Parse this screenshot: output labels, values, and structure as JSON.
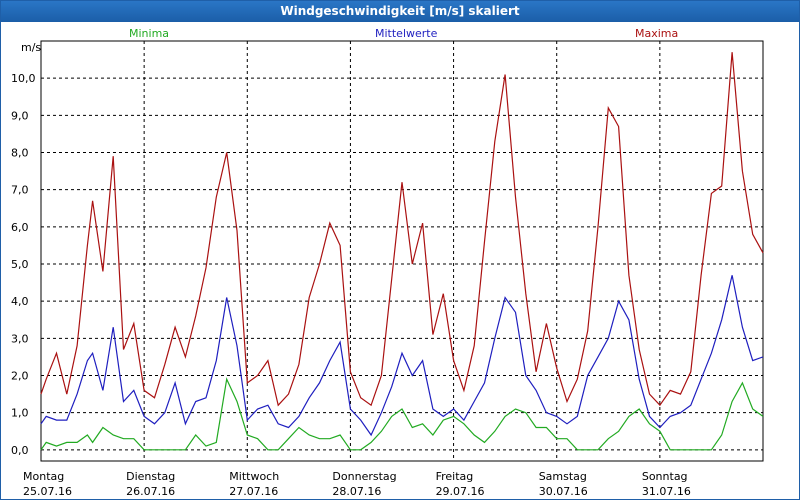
{
  "window": {
    "title": "Windgeschwindigkeit [m/s] skaliert"
  },
  "chart_data": {
    "type": "line",
    "title": "Windgeschwindigkeit [m/s] skaliert",
    "ylabel": "m/s",
    "ylim": [
      -0.3,
      11.0
    ],
    "yticks": [
      "0,0",
      "1,0",
      "2,0",
      "3,0",
      "4,0",
      "5,0",
      "6,0",
      "7,0",
      "8,0",
      "9,0",
      "10,0"
    ],
    "ytick_values": [
      0,
      1,
      2,
      3,
      4,
      5,
      6,
      7,
      8,
      9,
      10
    ],
    "xlim": [
      0,
      7
    ],
    "grid": true,
    "legend_position": "top",
    "days": [
      {
        "weekday": "Montag",
        "date": "25.07.16"
      },
      {
        "weekday": "Dienstag",
        "date": "26.07.16"
      },
      {
        "weekday": "Mittwoch",
        "date": "27.07.16"
      },
      {
        "weekday": "Donnerstag",
        "date": "28.07.16"
      },
      {
        "weekday": "Freitag",
        "date": "29.07.16"
      },
      {
        "weekday": "Samstag",
        "date": "30.07.16"
      },
      {
        "weekday": "Sonntag",
        "date": "31.07.16"
      }
    ],
    "series": [
      {
        "name": "Minima",
        "color": "#22aa22",
        "x": [
          0,
          0.05,
          0.15,
          0.25,
          0.35,
          0.45,
          0.5,
          0.6,
          0.7,
          0.8,
          0.9,
          1.0,
          1.1,
          1.2,
          1.3,
          1.4,
          1.5,
          1.6,
          1.7,
          1.8,
          1.9,
          2.0,
          2.1,
          2.2,
          2.3,
          2.4,
          2.5,
          2.6,
          2.7,
          2.8,
          2.9,
          3.0,
          3.1,
          3.2,
          3.3,
          3.4,
          3.5,
          3.6,
          3.7,
          3.8,
          3.9,
          4.0,
          4.1,
          4.2,
          4.3,
          4.4,
          4.5,
          4.6,
          4.7,
          4.8,
          4.9,
          5.0,
          5.1,
          5.2,
          5.3,
          5.4,
          5.5,
          5.6,
          5.7,
          5.8,
          5.9,
          6.0,
          6.1,
          6.2,
          6.3,
          6.4,
          6.5,
          6.6,
          6.7,
          6.8,
          6.9,
          7.0
        ],
        "values": [
          0.0,
          0.2,
          0.1,
          0.2,
          0.2,
          0.4,
          0.2,
          0.6,
          0.4,
          0.3,
          0.3,
          0.0,
          0.0,
          0.0,
          0.0,
          0.0,
          0.4,
          0.1,
          0.2,
          1.9,
          1.3,
          0.4,
          0.3,
          0.0,
          0.0,
          0.3,
          0.6,
          0.4,
          0.3,
          0.3,
          0.4,
          0.0,
          0.0,
          0.2,
          0.5,
          0.9,
          1.1,
          0.6,
          0.7,
          0.4,
          0.8,
          0.9,
          0.7,
          0.4,
          0.2,
          0.5,
          0.9,
          1.1,
          1.0,
          0.6,
          0.6,
          0.3,
          0.3,
          0.0,
          0.0,
          0.0,
          0.3,
          0.5,
          0.9,
          1.1,
          0.7,
          0.5,
          0.0,
          0.0,
          0.0,
          0.0,
          0.0,
          0.4,
          1.3,
          1.8,
          1.1,
          0.9
        ]
      },
      {
        "name": "Mittelwerte",
        "color": "#1f1fbf",
        "x": [
          0,
          0.05,
          0.15,
          0.25,
          0.35,
          0.45,
          0.5,
          0.6,
          0.7,
          0.8,
          0.9,
          1.0,
          1.1,
          1.2,
          1.3,
          1.4,
          1.5,
          1.6,
          1.7,
          1.8,
          1.9,
          2.0,
          2.1,
          2.2,
          2.3,
          2.4,
          2.5,
          2.6,
          2.7,
          2.8,
          2.9,
          3.0,
          3.1,
          3.2,
          3.3,
          3.4,
          3.5,
          3.6,
          3.7,
          3.8,
          3.9,
          4.0,
          4.1,
          4.2,
          4.3,
          4.4,
          4.5,
          4.6,
          4.7,
          4.8,
          4.9,
          5.0,
          5.1,
          5.2,
          5.3,
          5.4,
          5.5,
          5.6,
          5.7,
          5.8,
          5.9,
          6.0,
          6.1,
          6.2,
          6.3,
          6.4,
          6.5,
          6.6,
          6.7,
          6.8,
          6.9,
          7.0
        ],
        "values": [
          0.7,
          0.9,
          0.8,
          0.8,
          1.5,
          2.4,
          2.6,
          1.6,
          3.3,
          1.3,
          1.6,
          0.9,
          0.7,
          1.0,
          1.8,
          0.7,
          1.3,
          1.4,
          2.4,
          4.1,
          2.8,
          0.8,
          1.1,
          1.2,
          0.7,
          0.6,
          0.9,
          1.4,
          1.8,
          2.4,
          2.9,
          1.1,
          0.8,
          0.4,
          1.0,
          1.7,
          2.6,
          2.0,
          2.4,
          1.1,
          0.9,
          1.1,
          0.8,
          1.3,
          1.8,
          3.0,
          4.1,
          3.7,
          2.0,
          1.6,
          1.0,
          0.9,
          0.7,
          0.9,
          2.0,
          2.5,
          3.0,
          4.0,
          3.5,
          1.9,
          0.9,
          0.6,
          0.9,
          1.0,
          1.2,
          1.9,
          2.6,
          3.5,
          4.7,
          3.3,
          2.4,
          2.5
        ]
      },
      {
        "name": "Maxima",
        "color": "#aa1111",
        "x": [
          0,
          0.05,
          0.15,
          0.25,
          0.35,
          0.45,
          0.5,
          0.6,
          0.7,
          0.8,
          0.9,
          1.0,
          1.1,
          1.2,
          1.3,
          1.4,
          1.5,
          1.6,
          1.7,
          1.8,
          1.9,
          2.0,
          2.1,
          2.2,
          2.3,
          2.4,
          2.5,
          2.6,
          2.7,
          2.8,
          2.9,
          3.0,
          3.1,
          3.2,
          3.3,
          3.4,
          3.5,
          3.6,
          3.7,
          3.8,
          3.9,
          4.0,
          4.1,
          4.2,
          4.3,
          4.4,
          4.5,
          4.6,
          4.7,
          4.8,
          4.9,
          5.0,
          5.1,
          5.2,
          5.3,
          5.4,
          5.5,
          5.6,
          5.7,
          5.8,
          5.9,
          6.0,
          6.1,
          6.2,
          6.3,
          6.4,
          6.5,
          6.6,
          6.7,
          6.8,
          6.9,
          7.0
        ],
        "values": [
          1.5,
          1.9,
          2.6,
          1.5,
          2.8,
          5.5,
          6.7,
          4.8,
          7.9,
          2.7,
          3.4,
          1.6,
          1.4,
          2.3,
          3.3,
          2.5,
          3.6,
          4.9,
          6.8,
          8.0,
          5.9,
          1.8,
          2.0,
          2.4,
          1.2,
          1.5,
          2.3,
          4.1,
          5.0,
          6.1,
          5.5,
          2.1,
          1.4,
          1.2,
          2.0,
          4.6,
          7.2,
          5.0,
          6.1,
          3.1,
          4.2,
          2.4,
          1.6,
          2.8,
          5.6,
          8.3,
          10.1,
          6.8,
          4.2,
          2.1,
          3.4,
          2.2,
          1.3,
          1.9,
          3.2,
          6.0,
          9.2,
          8.7,
          4.7,
          2.7,
          1.5,
          1.2,
          1.6,
          1.5,
          2.1,
          4.7,
          6.9,
          7.1,
          10.7,
          7.5,
          5.8,
          5.3
        ]
      }
    ]
  }
}
